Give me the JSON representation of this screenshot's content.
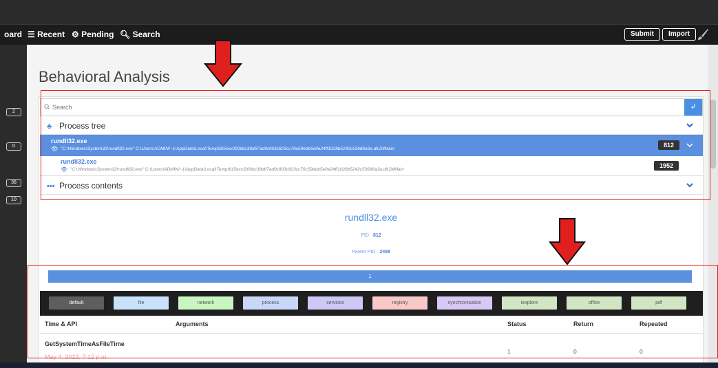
{
  "nav": {
    "dashboard_partial": "oard",
    "recent": "Recent",
    "pending": "Pending",
    "search": "Search",
    "submit": "Submit",
    "import": "Import"
  },
  "sidebar": {
    "badges": [
      "2",
      "0",
      "38",
      "10"
    ]
  },
  "page": {
    "title": "Behavioral Analysis"
  },
  "search": {
    "placeholder": "Search",
    "button": "↲"
  },
  "process_tree": {
    "title": "Process tree",
    "processes": [
      {
        "name": "rundll32.exe",
        "cmd": "\"C:\\Windows\\System32\\rundll32.exe\" C:\\Users\\ADMINI~1\\AppData\\Local\\Temp\\815eccf206bc39d67ad9c903c823cc76c59ebb5e0e24ff1028b5242c53686a3a.dll,DllMain",
        "pid": "812"
      },
      {
        "name": "rundll32.exe",
        "cmd": "\"C:\\Windows\\System32\\rundll32.exe\" C:\\Users\\ADMINI~1\\AppData\\Local\\Temp\\815eccf206bc39d67ad9c903c823cc76c59ebb5e0e24ff1028b5242c53686a3a.dll,DllMain",
        "pid": "1952"
      }
    ]
  },
  "process_contents": {
    "title": "Process contents"
  },
  "detail": {
    "name": "rundll32.exe",
    "pid_label": "PID",
    "pid": "812",
    "parent_pid_label": "Parent PID",
    "parent_pid": "2488"
  },
  "pagination": {
    "current_page": "1"
  },
  "categories": [
    {
      "label": "default",
      "color": "#5e5e5e"
    },
    {
      "label": "file",
      "color": "#c9e2fb"
    },
    {
      "label": "network",
      "color": "#c9f5c1"
    },
    {
      "label": "process",
      "color": "#c9d8f9"
    },
    {
      "label": "services",
      "color": "#cdc9f7"
    },
    {
      "label": "registry",
      "color": "#f9c9c9"
    },
    {
      "label": "synchronisation",
      "color": "#d6c9f3"
    },
    {
      "label": "iexplore",
      "color": "#d3e6c4"
    },
    {
      "label": "office",
      "color": "#d3e6c4"
    },
    {
      "label": "pdf",
      "color": "#d3e6c4"
    }
  ],
  "table": {
    "headers": [
      "Time & API",
      "Arguments",
      "Status",
      "Return",
      "Repeated"
    ],
    "rows": [
      {
        "api": "GetSystemTimeAsFileTime",
        "time": "May 4, 2022, 7:12 p.m.",
        "arguments": "",
        "status": "1",
        "return": "0",
        "repeated": "0"
      }
    ]
  },
  "colors": {
    "accent": "#5b8fe0",
    "annotation": "#e0201e",
    "navbar": "#1c1c1c"
  }
}
